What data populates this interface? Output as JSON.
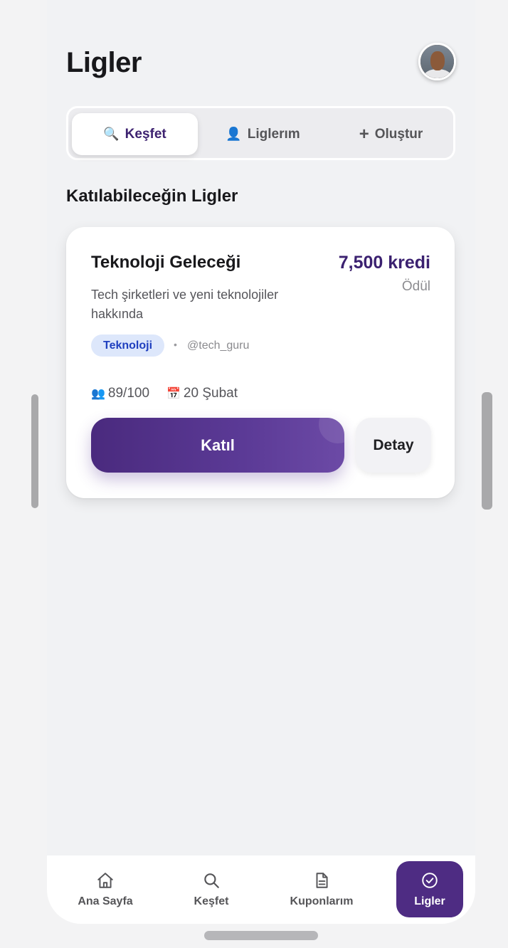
{
  "header": {
    "title": "Ligler"
  },
  "tabs": [
    {
      "icon": "search-icon",
      "label": "Keşfet",
      "active": true
    },
    {
      "icon": "person-icon",
      "label": "Liglerım",
      "active": false
    },
    {
      "icon": "plus-icon",
      "label": "Oluştur",
      "active": false
    }
  ],
  "section": {
    "title": "Katılabileceğin Ligler"
  },
  "league_card": {
    "title": "Teknoloji Geleceği",
    "prize": "7,500 kredi",
    "prize_label": "Ödül",
    "description": "Tech şirketleri ve yeni teknolojiler hakkında",
    "category": "Teknoloji",
    "separator": "•",
    "creator": "@tech_guru",
    "members": "89/100",
    "date": "20 Şubat",
    "join_label": "Katıl",
    "detail_label": "Detay"
  },
  "bottom_nav": [
    {
      "icon": "home-icon",
      "label": "Ana Sayfa",
      "active": false
    },
    {
      "icon": "search-icon",
      "label": "Keşfet",
      "active": false
    },
    {
      "icon": "document-icon",
      "label": "Kuponlarım",
      "active": false
    },
    {
      "icon": "badge-check-icon",
      "label": "Ligler",
      "active": true
    }
  ],
  "colors": {
    "accent": "#4e2c83",
    "badge_bg": "#dde7fb",
    "badge_text": "#1f3fbf"
  }
}
